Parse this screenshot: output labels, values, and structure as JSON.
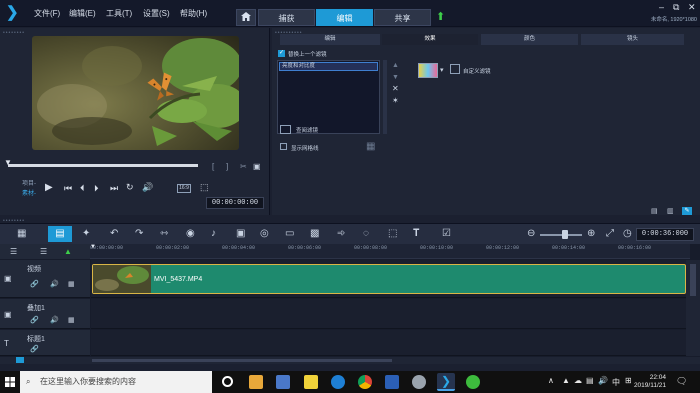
{
  "menu": {
    "items": [
      "文件(F)",
      "编辑(E)",
      "工具(T)",
      "设置(S)",
      "帮助(H)"
    ]
  },
  "workspace_tabs": [
    "捕获",
    "编辑",
    "共享"
  ],
  "project_info": "未命名, 1920*1080",
  "preview": {
    "project_label": "项目-",
    "clip_label": "素材-",
    "aspect_label": "16:9",
    "timecode": "00:00:00:00"
  },
  "options": {
    "tabs": [
      "编辑",
      "效果",
      "颜色",
      "镜头"
    ],
    "replace_filter_label": "替换上一个滤镜",
    "filter_item": "亮度和对比度",
    "custom_filter_label": "自定义滤镜",
    "compare_filter_label": "查阅滤镜",
    "show_grid_label": "显示网格线"
  },
  "toolbar": {
    "timecode": "0:00:36:000"
  },
  "timeline": {
    "ticks": [
      "00:00:00:00",
      "00:00:02:00",
      "00:00:04:00",
      "00:00:06:00",
      "00:00:08:00",
      "00:00:10:00",
      "00:00:12:00",
      "00:00:14:00",
      "00:00:16:00"
    ],
    "tracks": [
      "视频",
      "叠加1",
      "标题1"
    ],
    "clip_name": "MVI_5437.MP4"
  },
  "taskbar": {
    "search_placeholder": "在这里输入你要搜索的内容",
    "ime_label": "中",
    "time": "22:04",
    "date": "2019/11/21"
  },
  "colors": {
    "accent": "#1e9ad6",
    "clip": "#1e8a6e",
    "clip_border": "#d9b546"
  }
}
